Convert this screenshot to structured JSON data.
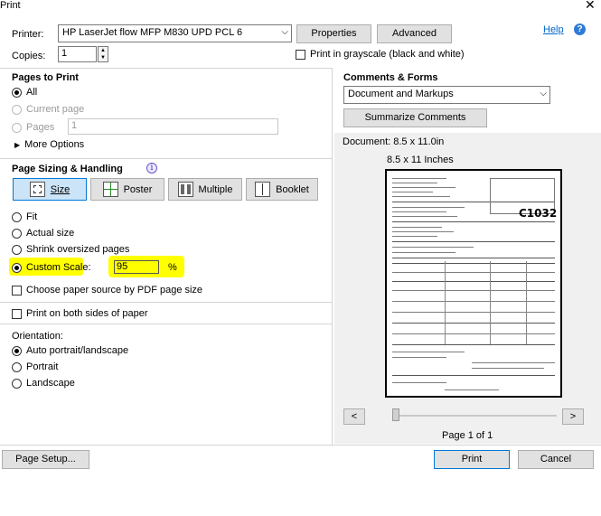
{
  "window": {
    "title": "Print"
  },
  "printer": {
    "label": "Printer:",
    "selected": "HP LaserJet flow MFP M830 UPD PCL 6",
    "properties_label": "Properties",
    "advanced_label": "Advanced",
    "help_label": "Help",
    "copies_label": "Copies:",
    "copies_value": "1",
    "grayscale_label": "Print in grayscale (black and white)"
  },
  "pages_to_print": {
    "heading": "Pages to Print",
    "all_label": "All",
    "current_page_label": "Current page",
    "pages_label": "Pages",
    "pages_value": "1",
    "more_options_label": "More Options"
  },
  "page_sizing": {
    "heading": "Page Sizing & Handling",
    "tabs": [
      "Size",
      "Poster",
      "Multiple",
      "Booklet"
    ],
    "fit_label": "Fit",
    "actual_size_label": "Actual size",
    "shrink_label": "Shrink oversized pages",
    "custom_scale_label": "Custom Scale:",
    "custom_scale_value": "95",
    "percent_sign": "%",
    "paper_source_label": "Choose paper source by PDF page size",
    "highlight_color": "#ffff00"
  },
  "both_sides_label": "Print on both sides of paper",
  "orientation": {
    "heading": "Orientation:",
    "auto_label": "Auto portrait/landscape",
    "portrait_label": "Portrait",
    "landscape_label": "Landscape"
  },
  "comments_forms": {
    "heading": "Comments & Forms",
    "selected": "Document and Markups",
    "summarize_label": "Summarize Comments"
  },
  "preview": {
    "document_size": "Document: 8.5 x 11.0in",
    "paper_size": "8.5 x 11 Inches",
    "prev_label": "<",
    "next_label": ">",
    "page_indicator": "Page 1 of 1",
    "stamp_text": "C1032"
  },
  "footer": {
    "page_setup_label": "Page Setup...",
    "print_label": "Print",
    "cancel_label": "Cancel"
  }
}
